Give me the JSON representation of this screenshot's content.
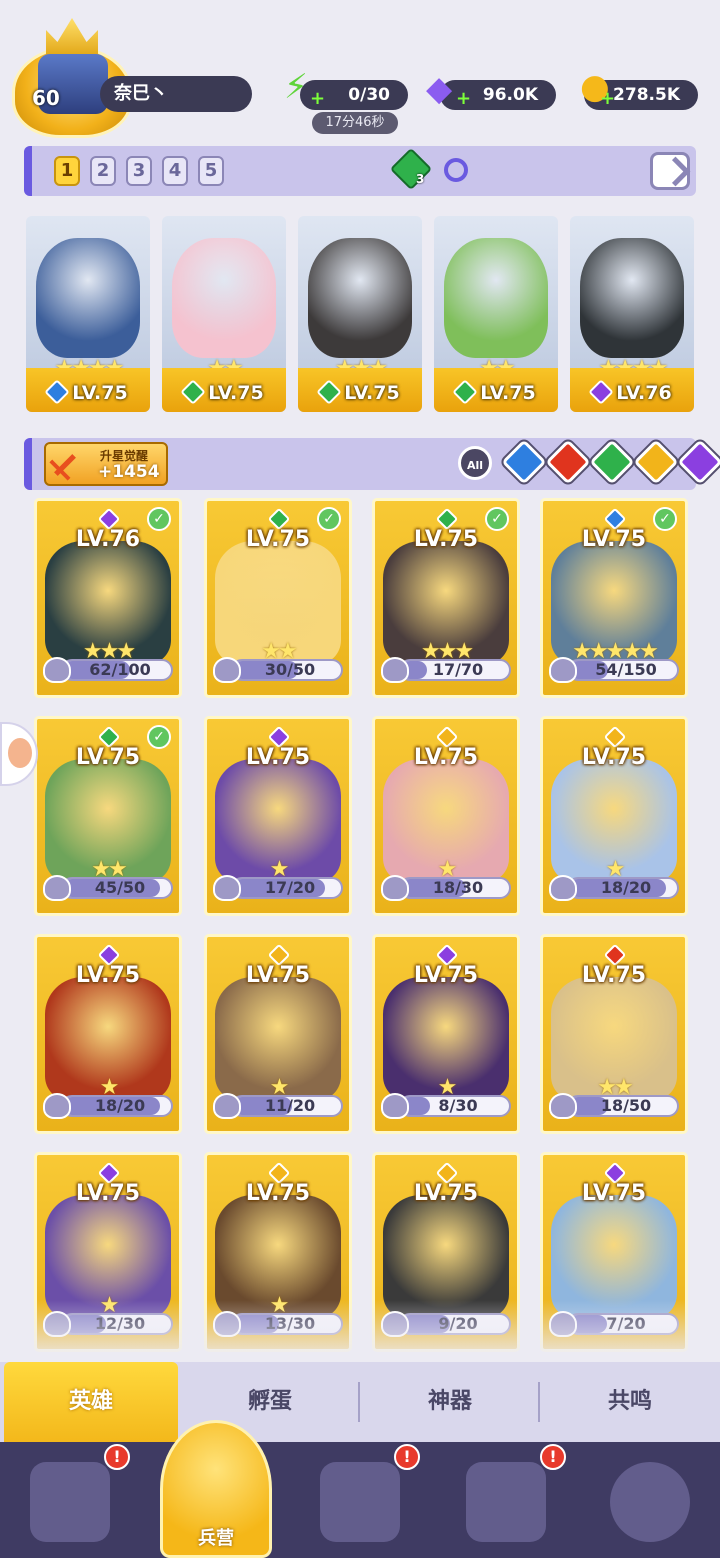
{
  "player": {
    "level": "60",
    "name": "奈巳丶"
  },
  "resources": {
    "energy": "0/30",
    "energy_timer": "17分46秒",
    "gems": "96.0K",
    "coins": "278.5K"
  },
  "team_slots": [
    "1",
    "2",
    "3",
    "4",
    "5"
  ],
  "team_gem_count": "3",
  "team": [
    {
      "level": "LV.75",
      "stars": "★★★★",
      "element": "water",
      "element_color": "#2e7fe0",
      "art": "#3c5e9a"
    },
    {
      "level": "LV.75",
      "stars": "★★",
      "element": "grass",
      "element_color": "#2fb14b",
      "art": "#f5c2cf"
    },
    {
      "level": "LV.75",
      "stars": "★★★",
      "element": "grass",
      "element_color": "#2fb14b",
      "art": "#3d3a3a"
    },
    {
      "level": "LV.75",
      "stars": "★★",
      "element": "grass",
      "element_color": "#2fb14b",
      "art": "#7fbf5a"
    },
    {
      "level": "LV.76",
      "stars": "★★★★",
      "element": "dark",
      "element_color": "#8b3fe0",
      "art": "#2f3438"
    }
  ],
  "awaken": {
    "label": "升星觉醒",
    "value": "+1454"
  },
  "filters": {
    "all": "All",
    "colors": [
      "#2e7fe0",
      "#e0341e",
      "#2fb14b",
      "#f2b41a",
      "#8b3fe0"
    ],
    "names": [
      "water",
      "fire",
      "grass",
      "light",
      "dark"
    ]
  },
  "heroes": [
    {
      "level": "LV.76",
      "count": "62/100",
      "progress": 0.62,
      "stars": "★★★",
      "checked": true,
      "element_color": "#8b3fe0",
      "art": "#2a3f42"
    },
    {
      "level": "LV.75",
      "count": "30/50",
      "progress": 0.6,
      "stars": "★★",
      "checked": true,
      "element_color": "#2fb14b",
      "art": "#f7d77a"
    },
    {
      "level": "LV.75",
      "count": "17/70",
      "progress": 0.24,
      "stars": "★★★",
      "checked": true,
      "element_color": "#2fb14b",
      "art": "#4a3d3d"
    },
    {
      "level": "LV.75",
      "count": "54/150",
      "progress": 0.36,
      "stars": "★★★★★",
      "checked": true,
      "element_color": "#2e7fe0",
      "art": "#5f7f9a"
    },
    {
      "level": "LV.75",
      "count": "45/50",
      "progress": 0.9,
      "stars": "★★",
      "checked": true,
      "element_color": "#2fb14b",
      "art": "#6ea45a"
    },
    {
      "level": "LV.75",
      "count": "17/20",
      "progress": 0.85,
      "stars": "★",
      "checked": false,
      "element_color": "#8b3fe0",
      "art": "#6d4ba8"
    },
    {
      "level": "LV.75",
      "count": "18/30",
      "progress": 0.6,
      "stars": "★",
      "checked": false,
      "element_color": "#f2b41a",
      "art": "#e6a9b0"
    },
    {
      "level": "LV.75",
      "count": "18/20",
      "progress": 0.9,
      "stars": "★",
      "checked": false,
      "element_color": "#f2b41a",
      "art": "#a9c3e8"
    },
    {
      "level": "LV.75",
      "count": "18/20",
      "progress": 0.9,
      "stars": "★",
      "checked": false,
      "element_color": "#8b3fe0",
      "art": "#b0381c"
    },
    {
      "level": "LV.75",
      "count": "11/20",
      "progress": 0.55,
      "stars": "★",
      "checked": false,
      "element_color": "#f2b41a",
      "art": "#8a6a4a"
    },
    {
      "level": "LV.75",
      "count": "8/30",
      "progress": 0.27,
      "stars": "★",
      "checked": false,
      "element_color": "#8b3fe0",
      "art": "#4a2f6e"
    },
    {
      "level": "LV.75",
      "count": "18/50",
      "progress": 0.36,
      "stars": "★★",
      "checked": false,
      "element_color": "#e0341e",
      "art": "#d9c08a"
    },
    {
      "level": "LV.75",
      "count": "12/30",
      "progress": 0.4,
      "stars": "★",
      "checked": false,
      "element_color": "#8b3fe0",
      "art": "#6b4fa8"
    },
    {
      "level": "LV.75",
      "count": "13/30",
      "progress": 0.43,
      "stars": "★",
      "checked": false,
      "element_color": "#f2b41a",
      "art": "#6a4a2e"
    },
    {
      "level": "LV.75",
      "count": "9/20",
      "progress": 0.45,
      "stars": "",
      "checked": false,
      "element_color": "#f2b41a",
      "art": "#3a3a3a"
    },
    {
      "level": "LV.75",
      "count": "7/20",
      "progress": 0.35,
      "stars": "",
      "checked": false,
      "element_color": "#8b3fe0",
      "art": "#8fb6de"
    }
  ],
  "subtabs": [
    "英雄",
    "孵蛋",
    "神器",
    "共鸣"
  ],
  "nav": {
    "active_label": "兵营",
    "badges": [
      "!",
      "!",
      "!"
    ]
  }
}
